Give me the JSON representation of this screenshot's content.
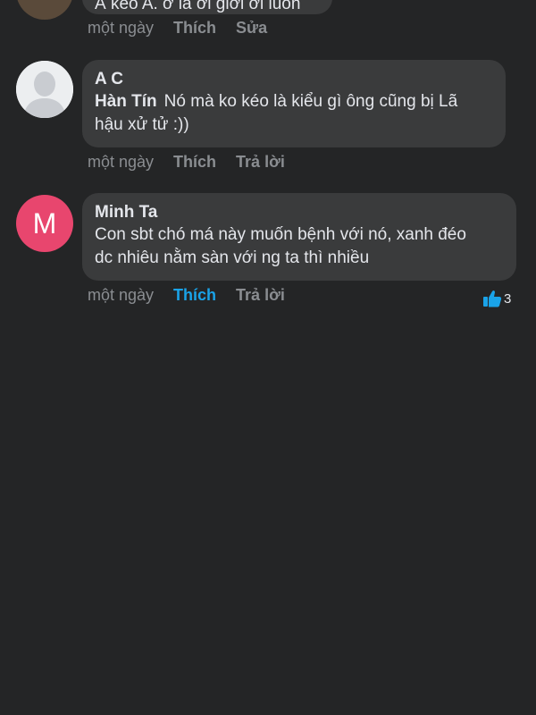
{
  "comments": [
    {
      "partial_text": "Á kéo A. ơ là ơi giới ơi luôn",
      "time": "một ngày",
      "like": "Thích",
      "action2": "Sửa"
    },
    {
      "author": "A C",
      "mention": "Hàn Tín",
      "text_line1": "Nó mà ko kéo là kiểu gì ông cũng bị Lã",
      "text_line2": "hậu xử tử :))",
      "time": "một ngày",
      "like": "Thích",
      "action2": "Trả lời",
      "avatar_icon": "default-user-icon"
    },
    {
      "author": "Minh Ta",
      "avatar_letter": "M",
      "avatar_color": "#e8466e",
      "text_line1": "Con sbt chó má này muốn bệnh với nó, xanh đéo",
      "text_line2": "dc nhiêu nằm sàn với ng ta thì nhiều",
      "time": "một ngày",
      "like": "Thích",
      "like_color": "#1aa3e8",
      "action2": "Trả lời",
      "reaction_count": "3",
      "reaction_icon": "thumbs-up-icon"
    }
  ]
}
